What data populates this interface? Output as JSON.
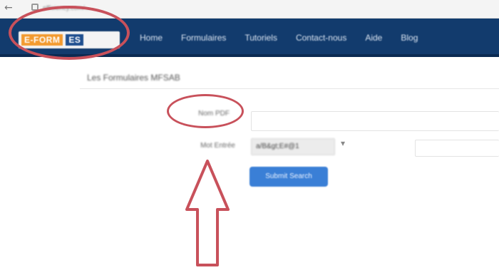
{
  "browser": {
    "back_icon": "←",
    "url": "efficiency.com/..."
  },
  "header": {
    "logo_left": "E-FORM",
    "logo_right": "ES",
    "nav": [
      "Home",
      "Formulaires",
      "Tutoriels",
      "Contact-nous",
      "Aide",
      "Blog"
    ]
  },
  "form": {
    "heading": "Les Formulaires MFSAB",
    "field1_label": "Nom PDF",
    "field2_label": "Mot Entrée",
    "select_value": "a/B&gt;E#@1",
    "caret": "▾",
    "submit_label": "Submit Search"
  },
  "annotations": {
    "color": "#c8515b"
  }
}
